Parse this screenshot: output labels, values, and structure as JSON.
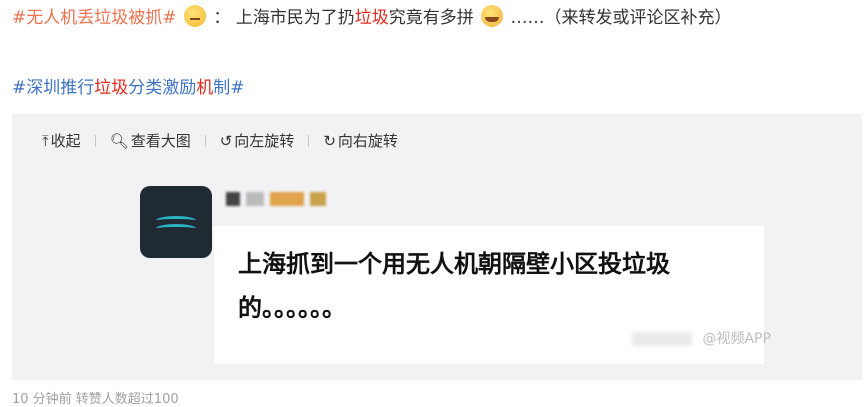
{
  "post": {
    "line1": {
      "hashtag": "#无人机丢垃圾被抓#",
      "colon": "：",
      "text_a": "上海市民为了扔",
      "text_red": "垃圾",
      "text_b": "究竟有多拼",
      "text_c": "……（来转发或评论区补充）"
    },
    "line2": {
      "a": "#深圳推行",
      "b": "垃圾",
      "c": "分类激励",
      "d": "机",
      "e": "制#"
    },
    "emoji_names": [
      "thinking-emoji",
      "laughing-crying-emoji"
    ]
  },
  "media": {
    "toolbar": {
      "collapse": "收起",
      "view_large": "查看大图",
      "rotate_left": "向左旋转",
      "rotate_right": "向右旋转"
    },
    "image": {
      "quote_line1": "上海抓到一个用无人机朝隔壁小区投垃圾",
      "quote_line2": "的。。。。。。",
      "watermark": "@视频APP"
    }
  },
  "footer": {
    "text": "10 分钟前 转赞人数超过100"
  },
  "colors": {
    "hashtag": "#eb7350",
    "topic": "#3f74c4",
    "highlight_red": "#e0281d",
    "media_bg": "#f2f2f5"
  }
}
